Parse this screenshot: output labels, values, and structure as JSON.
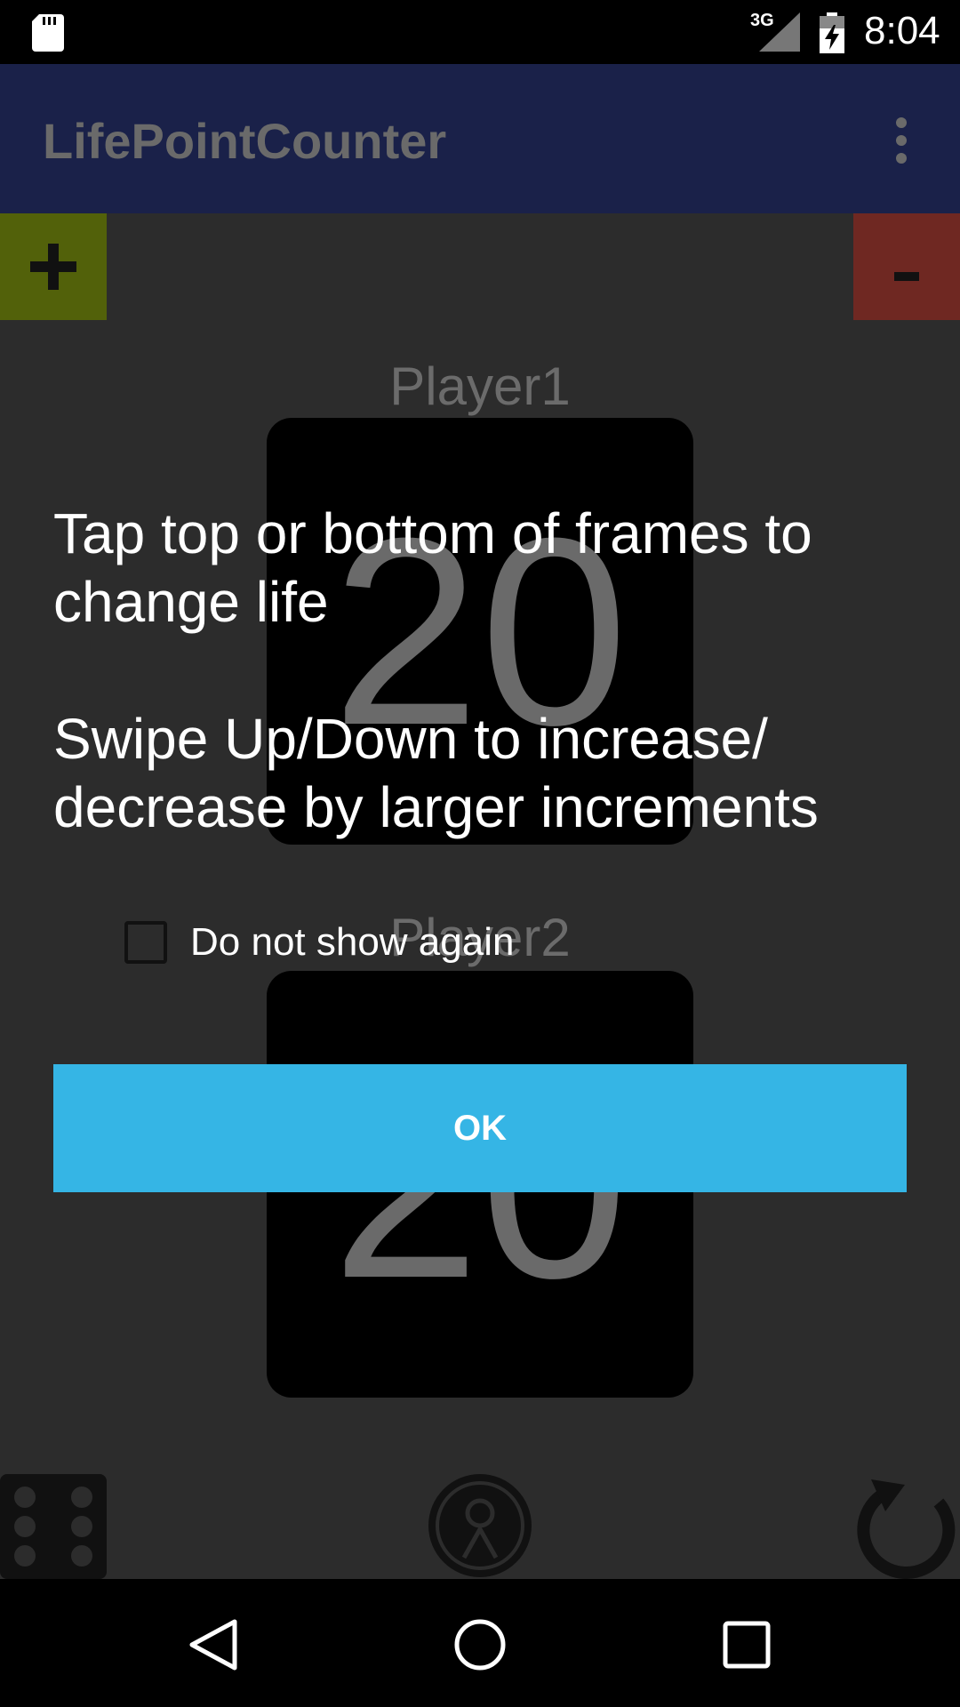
{
  "status_bar": {
    "network_label": "3G",
    "time": "8:04",
    "icons": [
      "sd-card-icon",
      "signal-icon",
      "battery-charging-icon"
    ]
  },
  "app_bar": {
    "title": "LifePointCounter",
    "menu_icon": "overflow-menu-icon"
  },
  "controls": {
    "plus_label": "+",
    "minus_label": "-"
  },
  "players": [
    {
      "name": "Player1",
      "life": "20"
    },
    {
      "name": "Player2",
      "life": "20"
    }
  ],
  "dialog": {
    "line1": "Tap top or bottom of frames to change life",
    "line2": "Swipe Up/Down to increase/ decrease by larger increments",
    "checkbox_label": "Do not show again",
    "checkbox_checked": false,
    "ok_label": "OK"
  },
  "bottom_bar": {
    "icons": [
      "dice-icon",
      "coin-icon",
      "reset-icon"
    ]
  },
  "nav_bar": {
    "icons": [
      "back-icon",
      "home-icon",
      "recents-icon"
    ]
  },
  "colors": {
    "app_bar": "#1a2149",
    "plus": "#52610a",
    "minus": "#6f2822",
    "ok_button": "#35b5e5",
    "background": "#2c2c2c"
  }
}
